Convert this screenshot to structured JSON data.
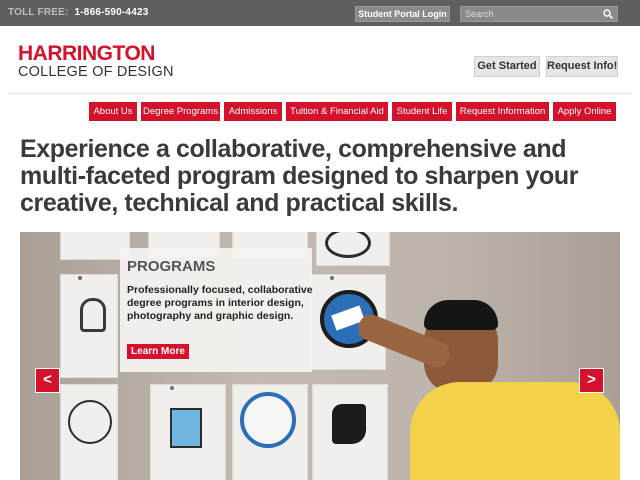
{
  "topbar": {
    "toll_label": "TOLL FREE:",
    "toll_number": "1-866-590-4423",
    "portal_button": "Student Portal Login",
    "search_placeholder": "Search"
  },
  "header": {
    "logo_line1": "HARRINGTON",
    "logo_line2": "COLLEGE OF DESIGN",
    "get_started": "Get Started",
    "request_info": "Request Info!"
  },
  "nav": {
    "items": [
      {
        "label": "About Us"
      },
      {
        "label": "Degree Programs"
      },
      {
        "label": "Admissions"
      },
      {
        "label": "Tuition & Financial Aid"
      },
      {
        "label": "Student Life"
      },
      {
        "label": "Request Information"
      },
      {
        "label": "Apply Online"
      }
    ]
  },
  "headline": "Experience a collaborative, comprehensive and multi-faceted program designed to sharpen your creative, technical and practical skills.",
  "hero": {
    "card_title": "PROGRAMS",
    "card_body": "Professionally focused, collaborative degree programs in interior design, photography and graphic design.",
    "learn_more": "Learn More",
    "prev_arrow": "<",
    "next_arrow": ">"
  },
  "colors": {
    "brand_red": "#d4122c",
    "topbar_gray": "#5f5f5f",
    "text_dark": "#3a3a3a"
  }
}
